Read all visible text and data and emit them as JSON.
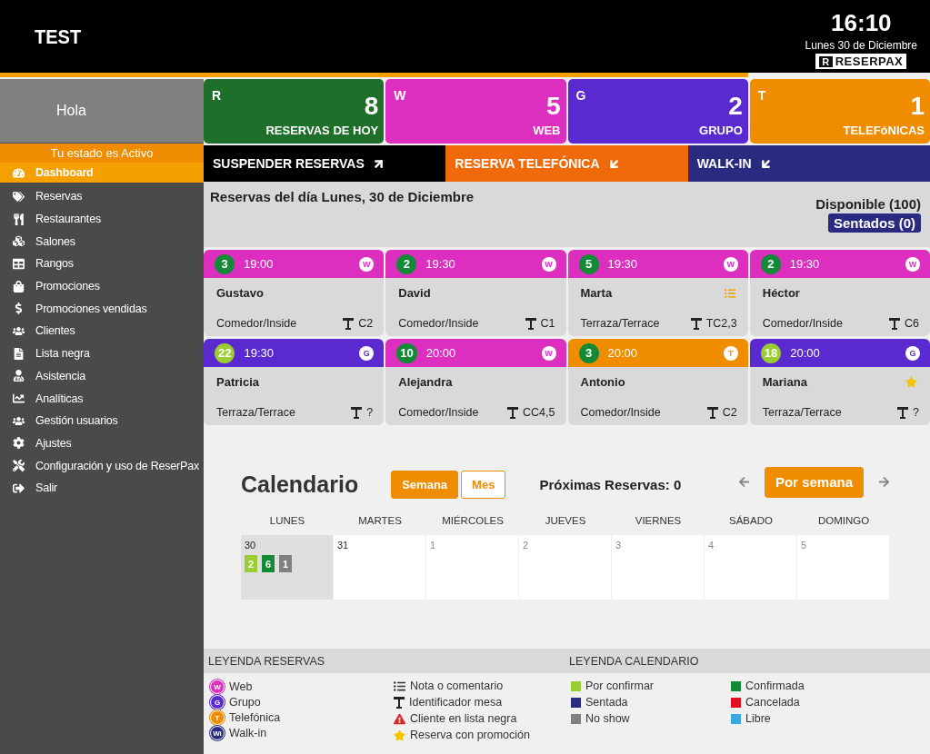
{
  "header": {
    "title": "TEST",
    "time": "16:10",
    "date": "Lunes 30 de Diciembre",
    "logo_mark": "R",
    "logo_text": "RESERPAX"
  },
  "sidebar": {
    "greeting": "Hola",
    "status": "Tu estado es Activo",
    "items": [
      {
        "label": "Dashboard",
        "selected": true
      },
      {
        "label": "Reservas",
        "selected": false
      },
      {
        "label": "Restaurantes",
        "selected": false
      },
      {
        "label": "Salones",
        "selected": false
      },
      {
        "label": "Rangos",
        "selected": false
      },
      {
        "label": "Promociones",
        "selected": false
      },
      {
        "label": "Promociones vendidas",
        "selected": false
      },
      {
        "label": "Clientes",
        "selected": false
      },
      {
        "label": "Lista negra",
        "selected": false
      },
      {
        "label": "Asistencia",
        "selected": false
      },
      {
        "label": "Analíticas",
        "selected": false
      },
      {
        "label": "Gestión usuarios",
        "selected": false
      },
      {
        "label": "Ajustes",
        "selected": false
      },
      {
        "label": "Configuración y uso de ReserPax",
        "selected": false
      },
      {
        "label": "Salir",
        "selected": false
      }
    ]
  },
  "stats": [
    {
      "letter": "R",
      "count": "8",
      "label": "RESERVAS DE HOY",
      "color": "#1e6f2a"
    },
    {
      "letter": "W",
      "count": "5",
      "label": "WEB",
      "color": "#dc2fc0"
    },
    {
      "letter": "G",
      "count": "2",
      "label": "GRUPO",
      "color": "#5a2ad0"
    },
    {
      "letter": "T",
      "count": "1",
      "label": "TELEFóNICAS",
      "color": "#ef8c00"
    }
  ],
  "actions": [
    {
      "label": "SUSPENDER RESERVAS",
      "kind": "out",
      "color": "#000000"
    },
    {
      "label": "RESERVA TELEFÓNICA",
      "kind": "in",
      "color": "#f06a0a"
    },
    {
      "label": "WALK-IN",
      "kind": "in",
      "color": "#2a2a80"
    }
  ],
  "day_panel": {
    "title": "Reservas del día Lunes, 30 de Diciembre",
    "available": "Disponible (100)",
    "seated": "Sentados (0)"
  },
  "reservations": [
    {
      "count": "3",
      "color": "#138a36",
      "time": "19:00",
      "channel": "W",
      "name": "Gustavo",
      "area": "Comedor/Inside",
      "table": "C2",
      "kind": "plain"
    },
    {
      "count": "2",
      "color": "#138a36",
      "time": "19:30",
      "channel": "W",
      "name": "David",
      "area": "Comedor/Inside",
      "table": "C1",
      "kind": "plain"
    },
    {
      "count": "5",
      "color": "#138a36",
      "time": "19:30",
      "channel": "W",
      "name": "Marta",
      "area": "Terraza/Terrace",
      "table": "TC2,3",
      "kind": "note"
    },
    {
      "count": "2",
      "color": "#138a36",
      "time": "19:30",
      "channel": "W",
      "name": "Héctor",
      "area": "Comedor/Inside",
      "table": "C6",
      "kind": "plain"
    },
    {
      "count": "22",
      "color": "#9acd32",
      "time": "19:30",
      "channel": "G",
      "name": "Patricia",
      "area": "Terraza/Terrace",
      "table": "?",
      "kind": "plain"
    },
    {
      "count": "10",
      "color": "#138a36",
      "time": "20:00",
      "channel": "W",
      "name": "Alejandra",
      "area": "Comedor/Inside",
      "table": "CC4,5",
      "kind": "plain"
    },
    {
      "count": "3",
      "color": "#138a36",
      "time": "20:00",
      "channel": "T",
      "name": "Antonio",
      "area": "Comedor/Inside",
      "table": "C2",
      "kind": "plain"
    },
    {
      "count": "18",
      "color": "#9acd32",
      "time": "20:00",
      "channel": "G",
      "name": "Mariana",
      "area": "Terraza/Terrace",
      "table": "?",
      "kind": "promo"
    }
  ],
  "calendar": {
    "title": "Calendario",
    "views": [
      {
        "label": "Semana",
        "selected": true
      },
      {
        "label": "Mes",
        "selected": false
      }
    ],
    "upcoming": "Próximas Reservas: 0",
    "mode": "Por semana",
    "weekdays": [
      "LUNES",
      "MARTES",
      "MIÉRCOLES",
      "JUEVES",
      "VIERNES",
      "SÁBADO",
      "DOMINGO"
    ],
    "days": [
      {
        "date": "30",
        "selected": true,
        "muted": false,
        "chips": [
          {
            "value": "2",
            "color": "#9acd32"
          },
          {
            "value": "6",
            "color": "#138a36"
          },
          {
            "value": "1",
            "color": "#808080"
          }
        ]
      },
      {
        "date": "31",
        "selected": false,
        "muted": false
      },
      {
        "date": "1",
        "selected": false,
        "muted": true
      },
      {
        "date": "2",
        "selected": false,
        "muted": true
      },
      {
        "date": "3",
        "selected": false,
        "muted": true
      },
      {
        "date": "4",
        "selected": false,
        "muted": true
      },
      {
        "date": "5",
        "selected": false,
        "muted": true
      }
    ]
  },
  "legend": {
    "reservations_title": "LEYENDA RESERVAS",
    "calendar_title": "LEYENDA CALENDARIO",
    "channels": [
      {
        "letter": "W",
        "label": "Web",
        "color": "#dc2fc0"
      },
      {
        "letter": "G",
        "label": "Grupo",
        "color": "#5a2ad0"
      },
      {
        "letter": "T",
        "label": "Telefónica",
        "color": "#ef8c00"
      },
      {
        "letter": "Wi",
        "label": "Walk-in",
        "color": "#2a2a80"
      }
    ],
    "symbols": [
      {
        "kind": "note",
        "label": "Nota o comentario"
      },
      {
        "kind": "table",
        "label": "Identificador mesa"
      },
      {
        "kind": "warning",
        "label": "Cliente en lista negra"
      },
      {
        "kind": "promo",
        "label": "Reserva con promoción"
      }
    ],
    "statuses": [
      {
        "label": "Por confirmar",
        "color": "#9acd32"
      },
      {
        "label": "Sentada",
        "color": "#2a2a80"
      },
      {
        "label": "No show",
        "color": "#808080"
      },
      {
        "label": "Confirmada",
        "color": "#138a36"
      },
      {
        "label": "Cancelada",
        "color": "#e01020"
      },
      {
        "label": "Libre",
        "color": "#3aa8e0"
      }
    ]
  }
}
